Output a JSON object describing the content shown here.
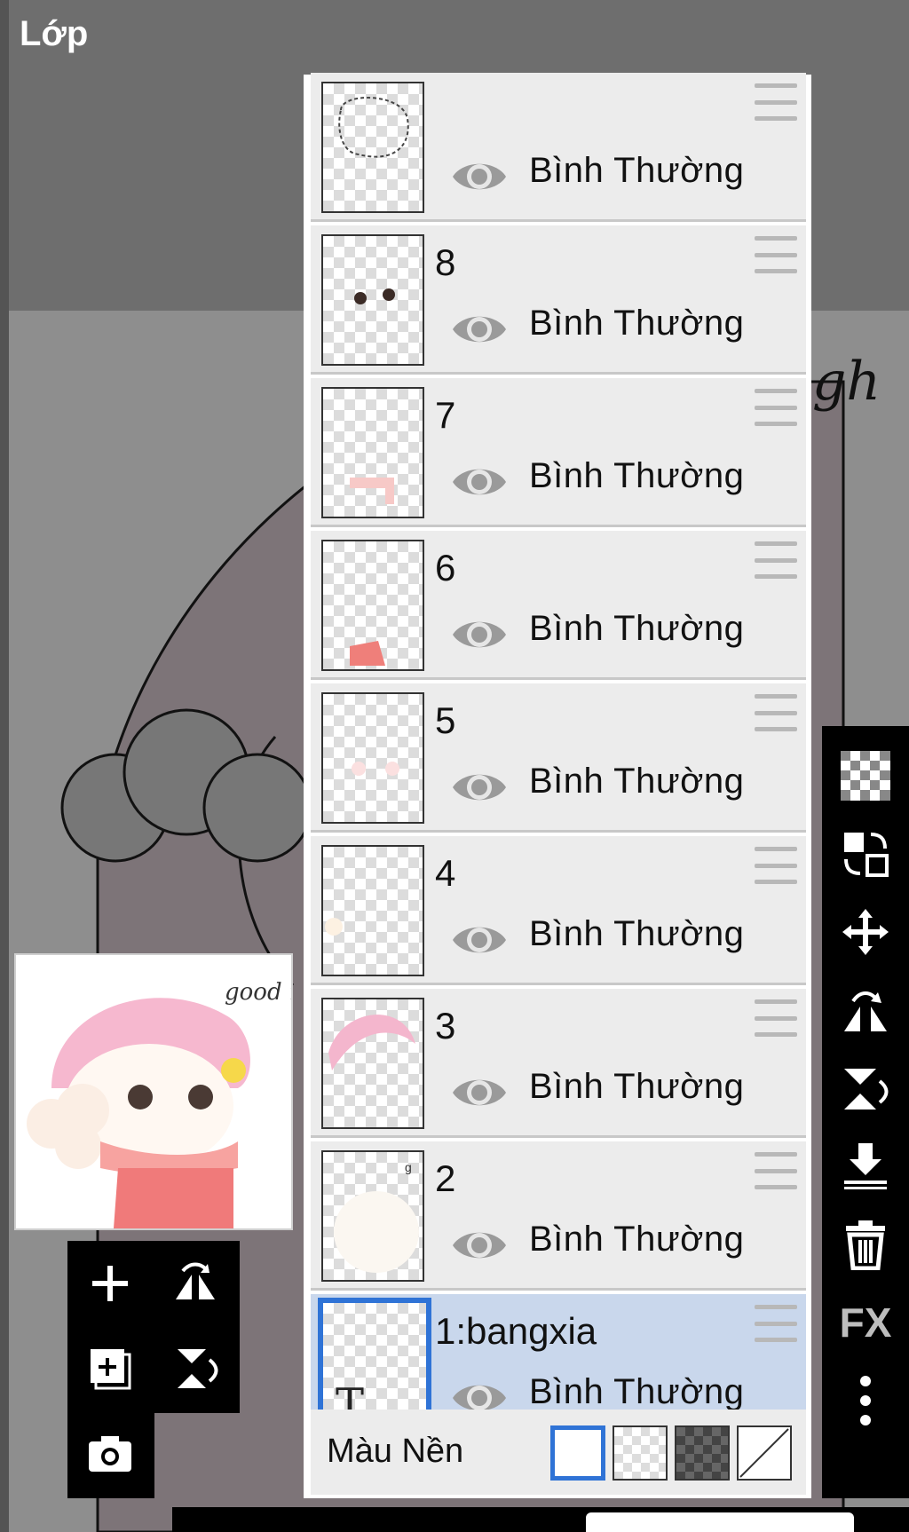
{
  "header": {
    "title": "Lớp"
  },
  "layers": [
    {
      "name": "",
      "mode": "Bình Thường"
    },
    {
      "name": "8",
      "mode": "Bình Thường"
    },
    {
      "name": "7",
      "mode": "Bình Thường"
    },
    {
      "name": "6",
      "mode": "Bình Thường"
    },
    {
      "name": "5",
      "mode": "Bình Thường"
    },
    {
      "name": "4",
      "mode": "Bình Thường"
    },
    {
      "name": "3",
      "mode": "Bình Thường"
    },
    {
      "name": "2",
      "mode": "Bình Thường"
    },
    {
      "name": "1:bangxia",
      "mode": "Bình Thường",
      "selected": true
    }
  ],
  "background": {
    "label": "Màu Nền",
    "options": [
      "white",
      "transparent-light",
      "transparent-dark",
      "none"
    ],
    "selected": "white"
  },
  "left_tools": [
    "add-layer-icon",
    "flip-horizontal-icon",
    "add-image-layer-icon",
    "flip-vertical-icon",
    "camera-icon"
  ],
  "right_tools": [
    "transparency-icon",
    "swap-layers-icon",
    "move-icon",
    "flip-h-rotate-icon",
    "flip-v-rotate-icon",
    "merge-down-icon",
    "trash-icon",
    "fx-icon",
    "more-icon"
  ],
  "fx_label": "FX",
  "thumbnail_text": "good night",
  "colors": {
    "selection_blue": "#2f73d6",
    "selected_row": "#c9d7ec"
  }
}
